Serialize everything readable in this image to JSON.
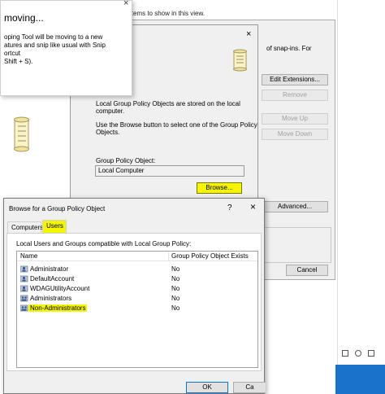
{
  "background": {
    "top_text": "items to show in this view."
  },
  "notification": {
    "title": "moving...",
    "lines": [
      "oping Tool will be moving to a new",
      "atures and snip like usual with Snip",
      "ortcut",
      "Shift + S)."
    ],
    "close_glyph": "×"
  },
  "snapin_panel": {
    "header_text": "of snap-ins. For",
    "buttons": {
      "edit_extensions": "Edit Extensions...",
      "remove": "Remove",
      "move_up": "Move Up",
      "move_down": "Move Down",
      "advanced": "Advanced...",
      "cancel": "Cancel"
    }
  },
  "gpo_dialog": {
    "close_glyph": "×",
    "desc1_line1": "Local Group Policy Objects are stored on the local",
    "desc1_line2": "computer.",
    "desc2_line1": "Use the Browse button to select one of the Group Policy",
    "desc2_line2": "Objects.",
    "gpo_label": "Group Policy Object:",
    "gpo_value": "Local Computer",
    "browse_label": "Browse..."
  },
  "browse_dialog": {
    "title": "Browse for a Group Policy Object",
    "help_glyph": "?",
    "close_glyph": "×",
    "tabs": [
      {
        "label": "Computers"
      },
      {
        "label": "Users"
      }
    ],
    "list_caption": "Local Users and Groups compatible with Local Group Policy:",
    "columns": [
      "Name",
      "Group Policy Object Exists"
    ],
    "rows": [
      {
        "name": "Administrator",
        "exists": "No"
      },
      {
        "name": "DefaultAccount",
        "exists": "No"
      },
      {
        "name": "WDAGUtilityAccount",
        "exists": "No"
      },
      {
        "name": "Administrators",
        "exists": "No"
      },
      {
        "name": "Non-Administrators",
        "exists": "No"
      }
    ],
    "ok_label": "OK",
    "cancel_label": "Ca"
  },
  "colors": {
    "highlight": "#f5f500",
    "accent": "#0078d7"
  }
}
